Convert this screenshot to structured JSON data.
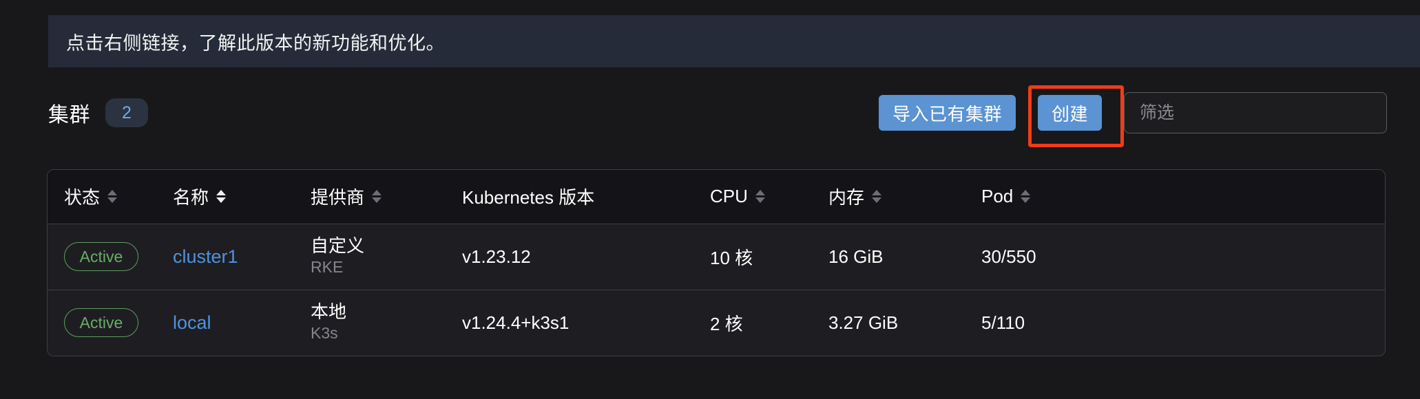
{
  "banner": {
    "text": "点击右侧链接，了解此版本的新功能和优化。"
  },
  "header": {
    "title": "集群",
    "count": "2",
    "import_button": "导入已有集群",
    "create_button": "创建",
    "filter_placeholder": "筛选",
    "filter_value": ""
  },
  "table": {
    "columns": [
      {
        "label": "状态",
        "sortable": true,
        "sorted": false
      },
      {
        "label": "名称",
        "sortable": true,
        "sorted": true
      },
      {
        "label": "提供商",
        "sortable": true,
        "sorted": false
      },
      {
        "label": "Kubernetes 版本",
        "sortable": false,
        "sorted": false
      },
      {
        "label": "CPU",
        "sortable": true,
        "sorted": false
      },
      {
        "label": "内存",
        "sortable": true,
        "sorted": false
      },
      {
        "label": "Pod",
        "sortable": true,
        "sorted": false
      }
    ],
    "rows": [
      {
        "state": "Active",
        "name": "cluster1",
        "provider": "自定义",
        "provider_sub": "RKE",
        "k8s_version": "v1.23.12",
        "cpu": "10 核",
        "memory": "16 GiB",
        "pods": "30/550"
      },
      {
        "state": "Active",
        "name": "local",
        "provider": "本地",
        "provider_sub": "K3s",
        "k8s_version": "v1.24.4+k3s1",
        "cpu": "2 核",
        "memory": "3.27 GiB",
        "pods": "5/110"
      }
    ]
  },
  "colors": {
    "page_bg": "#18181b",
    "banner_bg": "#252b38",
    "primary_button": "#5b93d3",
    "highlight_box": "#f03c18",
    "link": "#4e93e0",
    "status_active": "#6aab6a",
    "badge_text": "#6fa9e8"
  }
}
